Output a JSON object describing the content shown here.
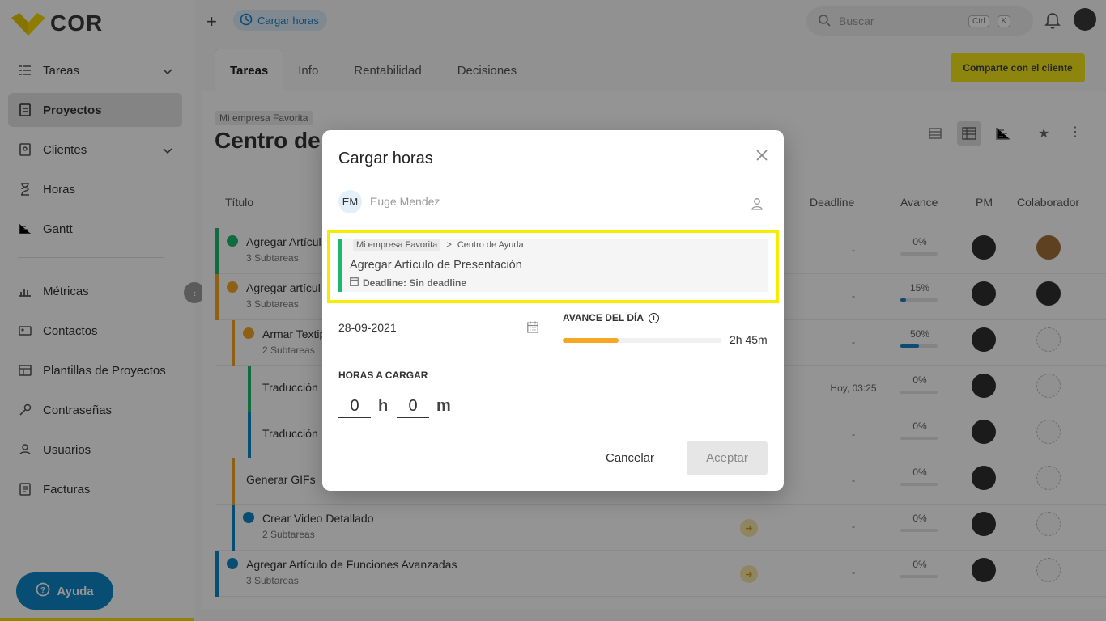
{
  "app": {
    "logo_text": "COR",
    "brand_yellow": "#f5e400",
    "accent_blue": "#1b80c4"
  },
  "sidebar": {
    "items": [
      {
        "label": "Tareas",
        "icon": "tasks-icon"
      },
      {
        "label": "Proyectos",
        "icon": "folder-icon"
      },
      {
        "label": "Clientes",
        "icon": "clients-icon"
      },
      {
        "label": "Horas",
        "icon": "hourglass-icon"
      },
      {
        "label": "Gantt",
        "icon": "gantt-icon"
      },
      {
        "label": "Métricas",
        "icon": "metrics-icon"
      },
      {
        "label": "Contactos",
        "icon": "contacts-icon"
      },
      {
        "label": "Plantillas de Proyectos",
        "icon": "templates-icon"
      },
      {
        "label": "Contraseñas",
        "icon": "key-icon"
      },
      {
        "label": "Usuarios",
        "icon": "users-icon"
      },
      {
        "label": "Facturas",
        "icon": "invoice-icon"
      }
    ],
    "help_label": "Ayuda"
  },
  "topbar": {
    "cargar_chip": "Cargar horas",
    "search_placeholder": "Buscar",
    "kbd_ctrl": "Ctrl",
    "kbd_k": "K"
  },
  "project": {
    "tabs": [
      "Tareas",
      "Info",
      "Rentabilidad",
      "Decisiones"
    ],
    "share_label": "Comparte con el cliente",
    "client_chip": "Mi empresa Favorita",
    "title": "Centro de"
  },
  "table": {
    "headers": {
      "titulo": "Título",
      "deadline": "Deadline",
      "avance": "Avance",
      "pm": "PM",
      "colaborador": "Colaborador"
    },
    "rows": [
      {
        "title": "Agregar Artícul",
        "sub": "3 Subtareas",
        "deadline": "-",
        "pct": "0%",
        "progress": 0,
        "color": "#1cb86b"
      },
      {
        "title": "Agregar artícul",
        "sub": "3 Subtareas",
        "deadline": "-",
        "pct": "15%",
        "progress": 0.15,
        "color": "#f5a623"
      },
      {
        "title": "Armar Textip",
        "sub": "2 Subtareas",
        "deadline": "-",
        "pct": "50%",
        "progress": 0.5,
        "color": "#f5a623"
      },
      {
        "title": "Traducción ",
        "sub": "",
        "deadline": "Hoy, 03:25",
        "pct": "0%",
        "progress": 0,
        "color": "#1cb86b"
      },
      {
        "title": "Traducción ",
        "sub": "",
        "deadline": "-",
        "pct": "0%",
        "progress": 0,
        "color": "#0e86c9"
      },
      {
        "title": "Generar GIFs",
        "sub": "",
        "deadline": "-",
        "pct": "0%",
        "progress": 0,
        "color": "#f5a623"
      },
      {
        "title": "Crear Video Detallado",
        "sub": "2 Subtareas",
        "deadline": "-",
        "pct": "0%",
        "progress": 0,
        "color": "#0e86c9"
      },
      {
        "title": "Agregar Artículo de Funciones Avanzadas",
        "sub": "3 Subtareas",
        "deadline": "-",
        "pct": "0%",
        "progress": 0,
        "color": "#0e86c9"
      }
    ]
  },
  "modal": {
    "title": "Cargar horas",
    "user_initials": "EM",
    "user_name": "Euge Mendez",
    "task": {
      "client": "Mi empresa Favorita",
      "separator": ">",
      "project": "Centro de Ayuda",
      "name": "Agregar Artículo de Presentación",
      "deadline": "Deadline: Sin deadline"
    },
    "date": "28-09-2021",
    "avance_label": "AVANCE DEL DÍA",
    "avance_value": "2h 45m",
    "avance_progress": 0.35,
    "horas_label": "HORAS A CARGAR",
    "hours": "0",
    "hours_unit": "h",
    "minutes": "0",
    "minutes_unit": "m",
    "cancel_label": "Cancelar",
    "accept_label": "Aceptar"
  }
}
